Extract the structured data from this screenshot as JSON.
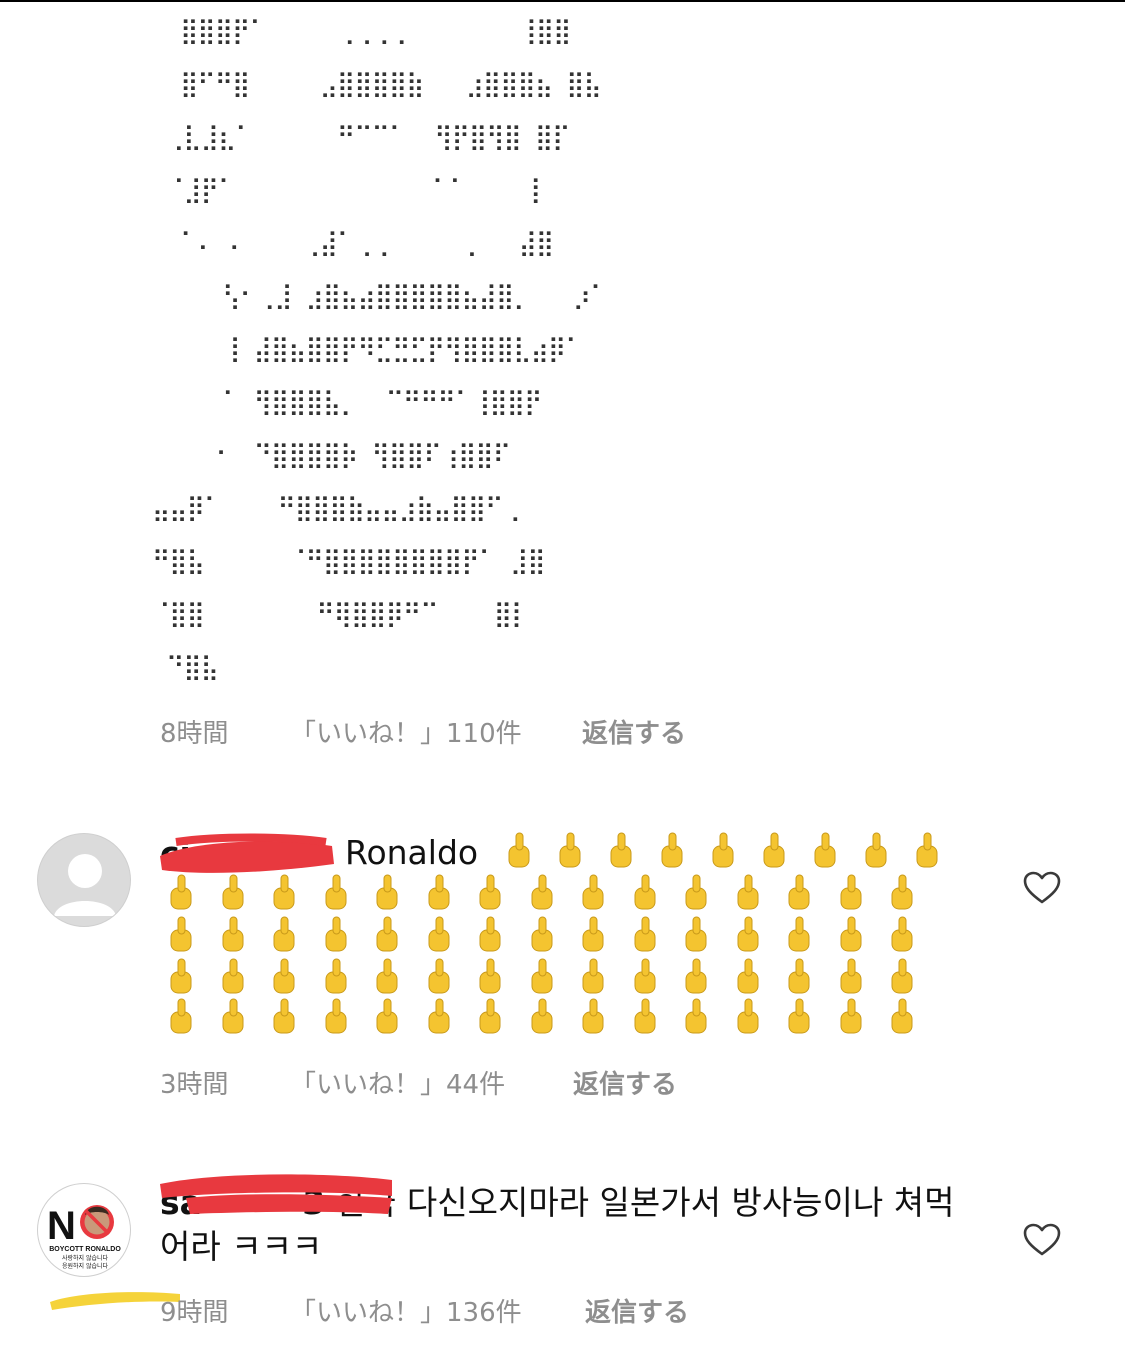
{
  "ascii_art": [
    "  ⣿⣿⣿⡟⠁     ⢀⢀⢀⢀        ⢸⣿⣿",
    "  ⣿⠋⠛⣿     ⣠⣿⣿⣿⣿⣷   ⣰⣿⣿⣿⣦ ⣿⣧",
    " ⢀⣇⣸⣆⠁      ⠛⠉⠉⠁  ⢻⡟⣿⢻⣿ ⣿⡏",
    " ⠈⣸⡟⠁              ⠁⠁    ⢸",
    "  ⠁⠄ ⠄    ⢀⣼⠁⢀⢀     ⢀   ⣼⣿",
    "     ⢣⠂⢀⣸ ⣰⣿⣦⣴⣿⣿⣿⣿⣿⣦⣼⣿⡀   ⡰⠁",
    "     ⢸ ⣼⣿⣦⣿⣿⡟⠻⣋⣛⣋⡟⢻⣿⣿⣿⣇⣴⡿⠁",
    "     ⠁ ⢻⣿⣿⣿⣧⡀  ⠉⠛⠛⠛⠁⢸⣿⣿⡟",
    "    ⠐  ⠙⣿⣿⣿⣿⡷ ⢻⣿⣿⠏⢰⣿⣿⠏",
    "⣤⣤⡿⠁    ⠛⣿⣿⣿⣷⣤⣤⣰⣷⣤⣿⣿⠋⢀",
    "⠛⣿⣧      ⠈⠛⣿⣿⣿⣿⣿⣿⣿⣿⡟⠁ ⣸⣿",
    "⠈⣿⣿        ⠛⢿⣿⣿⡿⠛⠉    ⣿⡇",
    " ⠙⣿⣧"
  ],
  "comments": [
    {
      "time": "8時間",
      "likes": "「いいね！」110件",
      "reply": "返信する"
    },
    {
      "username": "ci········4",
      "text": "Ronaldo",
      "emoji": "middle-finger-emoji",
      "emoji_count": 74,
      "time": "3時間",
      "likes": "「いいね！」44件",
      "reply": "返信する",
      "avatar": "default-user-icon",
      "like_icon": "heart-outline-icon"
    },
    {
      "username": "sa········3",
      "text": "한국 다신오지마라 일본가서 방사능이나 쳐먹어라 ㅋㅋㅋ",
      "time": "9時間",
      "likes": "「いいね！」136件",
      "reply": "返信する",
      "avatar": {
        "icon": "no-boycott-badge-icon",
        "letter": "N",
        "line1": "BOYCOTT RONALDO",
        "line2": "사랑하지 않습니다",
        "line3": "응원하지 않습니다"
      },
      "like_icon": "heart-outline-icon"
    }
  ],
  "colors": {
    "meta_gray": "#8e8e8e",
    "redaction_red": "#e8393f",
    "highlight_yellow": "#f5d33a",
    "emoji_yellow": "#f4c430"
  }
}
